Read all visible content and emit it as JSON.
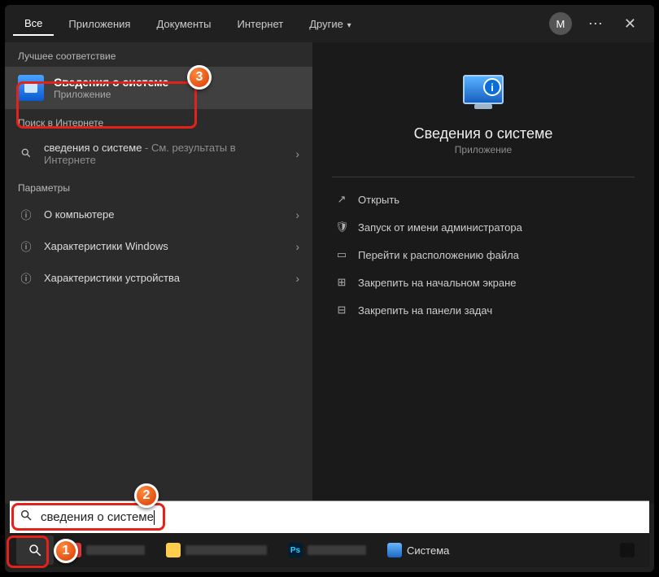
{
  "tabs": {
    "items": [
      "Все",
      "Приложения",
      "Документы",
      "Интернет",
      "Другие"
    ],
    "avatar_letter": "M"
  },
  "left": {
    "best_match_header": "Лучшее соответствие",
    "best_match": {
      "title": "Сведения о системе",
      "subtitle": "Приложение"
    },
    "web_header": "Поиск в Интернете",
    "web_item": {
      "query": "сведения о системе",
      "suffix": " - См. результаты в Интернете"
    },
    "settings_header": "Параметры",
    "settings": [
      "О компьютере",
      "Характеристики Windows",
      "Характеристики устройства"
    ]
  },
  "right": {
    "title": "Сведения о системе",
    "subtitle": "Приложение",
    "actions": [
      {
        "icon": "open",
        "label": "Открыть"
      },
      {
        "icon": "admin",
        "label": "Запуск от имени администратора"
      },
      {
        "icon": "folder",
        "label": "Перейти к расположению файла"
      },
      {
        "icon": "pin-start",
        "label": "Закрепить на начальном экране"
      },
      {
        "icon": "pin-taskbar",
        "label": "Закрепить на панели задач"
      }
    ]
  },
  "search": {
    "value": "сведения о системе"
  },
  "taskbar": {
    "system_label": "Система"
  },
  "annotations": {
    "n1": "1",
    "n2": "2",
    "n3": "3"
  }
}
